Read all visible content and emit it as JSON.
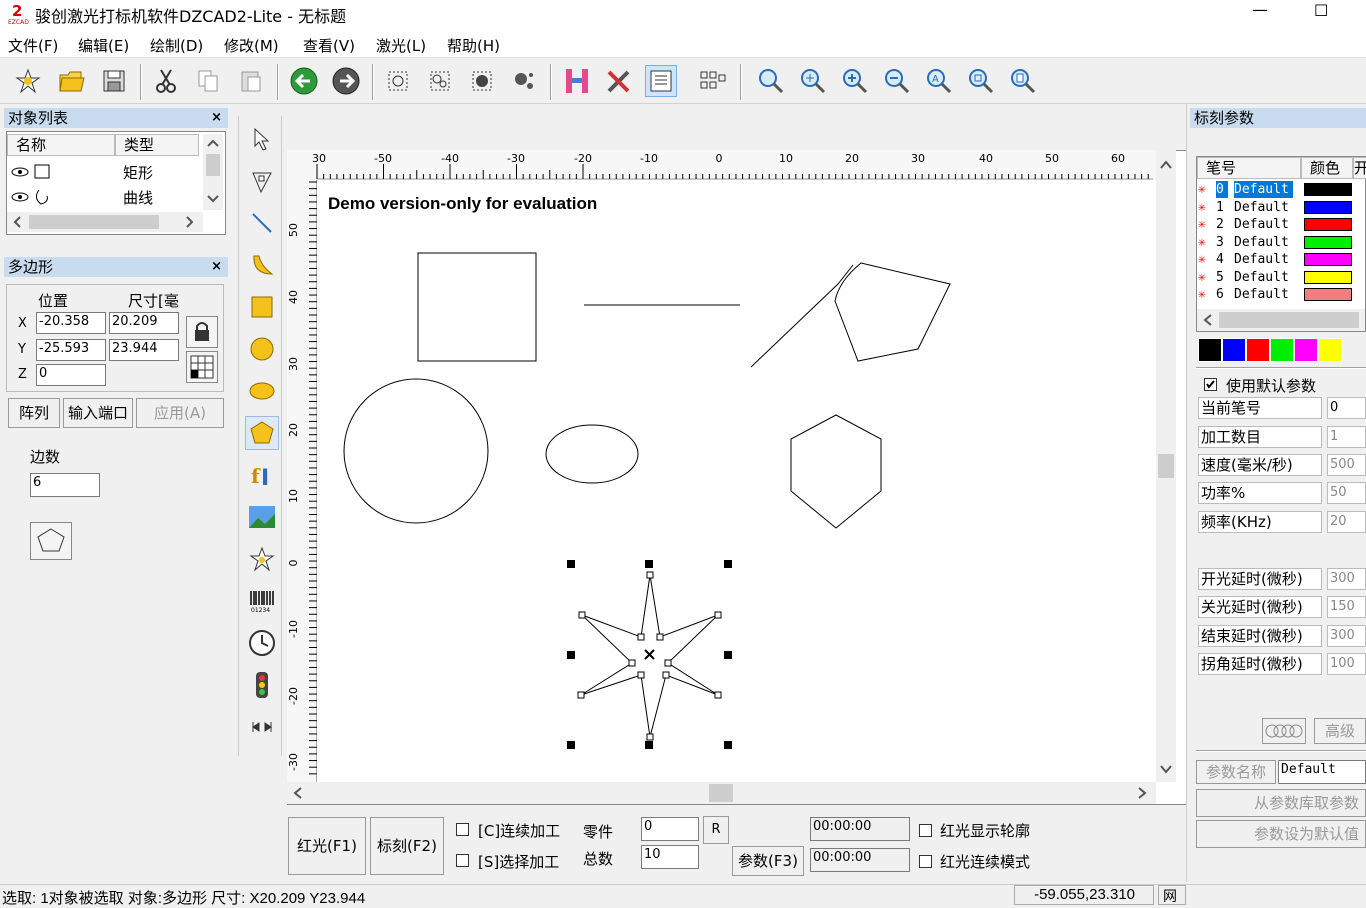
{
  "window": {
    "title": "骏创激光打标机软件DZCAD2-Lite  - 无标题",
    "logo_text": "EZCAD",
    "minimize_glyph": "—",
    "maximize_glyph": "☐"
  },
  "menu": [
    "文件(F)",
    "编辑(E)",
    "绘制(D)",
    "修改(M)",
    "查看(V)",
    "激光(L)",
    "帮助(H)"
  ],
  "object_list": {
    "title": "对象列表",
    "close": "×",
    "col_name": "名称",
    "col_type": "类型",
    "rows": [
      {
        "type": "矩形"
      },
      {
        "type": "曲线"
      }
    ]
  },
  "properties": {
    "title": "多边形",
    "close": "×",
    "pos_label": "位置",
    "size_label": "尺寸[毫",
    "x_label": "X",
    "y_label": "Y",
    "z_label": "Z",
    "x_pos": "-20.358",
    "x_size": "20.209",
    "y_pos": "-25.593",
    "y_size": "23.944",
    "z_pos": "0",
    "array_btn": "阵列",
    "input_port_btn": "输入端口",
    "apply_btn": "应用(A)",
    "sides_label": "边数",
    "sides_value": "6"
  },
  "canvas": {
    "watermark": "Demo version-only for evaluation",
    "ruler_top": [
      "30",
      "-50",
      "-40",
      "-30",
      "-20",
      "-10",
      "0",
      "10",
      "20",
      "30",
      "40",
      "50",
      "60"
    ],
    "ruler_left": [
      "50",
      "40",
      "30",
      "20",
      "10",
      "0",
      "-10",
      "-20",
      "-30"
    ]
  },
  "bottom": {
    "red_light_btn": "红光(F1)",
    "mark_btn": "标刻(F2)",
    "continuous_label": "[C]连续加工",
    "select_label": "[S]选择加工",
    "part_label": "零件",
    "total_label": "总数",
    "part_value": "0",
    "total_value": "10",
    "r_btn": "R",
    "param_btn": "参数(F3)",
    "time1": "00:00:00",
    "time2": "00:00:00",
    "red_contour_label": "红光显示轮廓",
    "red_continuous_label": "红光连续模式"
  },
  "mark_params": {
    "title": "标刻参数",
    "col_pen": "笔号",
    "col_color": "颜色",
    "col_on": "开",
    "pens": [
      {
        "num": "0",
        "name": "Default",
        "color": "#000000"
      },
      {
        "num": "1",
        "name": "Default",
        "color": "#0000ff"
      },
      {
        "num": "2",
        "name": "Default",
        "color": "#ff0000"
      },
      {
        "num": "3",
        "name": "Default",
        "color": "#00ee00"
      },
      {
        "num": "4",
        "name": "Default",
        "color": "#ff00ff"
      },
      {
        "num": "5",
        "name": "Default",
        "color": "#ffff00"
      },
      {
        "num": "6",
        "name": "Default",
        "color": "#f08080"
      }
    ],
    "palette": [
      "#000000",
      "#0000ff",
      "#ff0000",
      "#00ee00",
      "#ff00ff",
      "#ffff00"
    ],
    "use_default_label": "使用默认参数",
    "current_pen_label": "当前笔号",
    "current_pen": "0",
    "count_label": "加工数目",
    "count": "1",
    "speed_label": "速度(毫米/秒)",
    "speed": "500",
    "power_label": "功率%",
    "power": "50",
    "freq_label": "频率(KHz)",
    "freq": "20",
    "on_delay_label": "开光延时(微秒)",
    "on_delay": "300",
    "off_delay_label": "关光延时(微秒)",
    "off_delay": "150",
    "end_delay_label": "结束延时(微秒)",
    "end_delay": "300",
    "corner_delay_label": "拐角延时(微秒)",
    "corner_delay": "100",
    "advanced_btn": "高级",
    "param_name_label": "参数名称",
    "param_name": "Default",
    "from_lib_btn": "从参数库取参数",
    "set_default_btn": "参数设为默认值"
  },
  "status": {
    "text": "选取: 1对象被选取 对象:多边形 尺寸: X20.209 Y23.944",
    "coords": "-59.055,23.310",
    "extra": "网"
  }
}
